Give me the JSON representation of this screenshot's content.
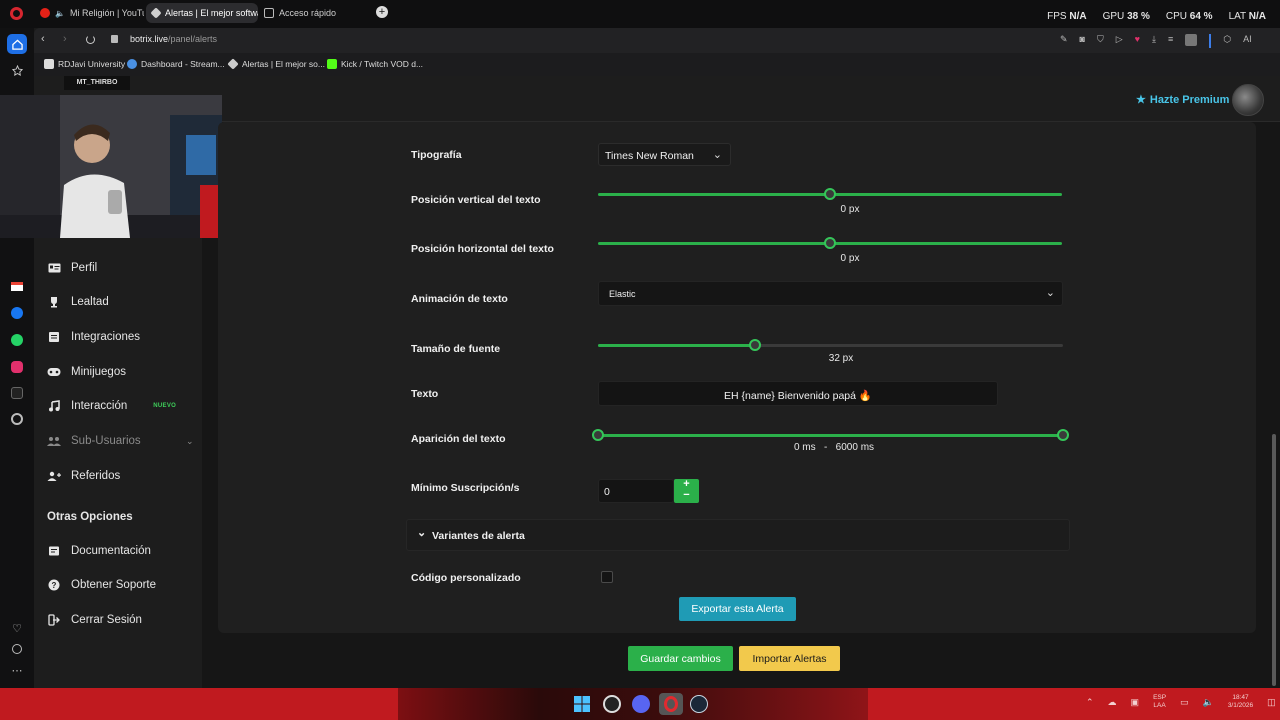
{
  "browser": {
    "tabs": [
      {
        "label": "Mi Religión | YouTube",
        "active": false
      },
      {
        "label": "Alertas | El mejor software",
        "active": true
      },
      {
        "label": "Acceso rápido",
        "active": false
      }
    ],
    "url_host": "botrix.live",
    "url_path": "/panel/alerts",
    "bookmarks": [
      "RDJavi University",
      "Dashboard - Stream...",
      "Alertas | El mejor so...",
      "Kick / Twitch VOD d..."
    ],
    "hud": {
      "fps_label": "FPS",
      "fps_value": "N/A",
      "gpu_label": "GPU",
      "gpu_value": "38 %",
      "cpu_label": "CPU",
      "cpu_value": "64 %",
      "lat_label": "LAT",
      "lat_value": "N/A"
    },
    "ai_label": "AI"
  },
  "stream_overlay": {
    "streamer_tag": "MT_THIRBO"
  },
  "header": {
    "premium_label": "Hazte Premium"
  },
  "sidebar": {
    "items": [
      {
        "label": "Perfil",
        "icon": "id-card-icon"
      },
      {
        "label": "Lealtad",
        "icon": "trophy-icon"
      },
      {
        "label": "Integraciones",
        "icon": "plug-icon"
      },
      {
        "label": "Minijuegos",
        "icon": "gamepad-icon"
      },
      {
        "label": "Interacción",
        "icon": "music-icon",
        "badge": "NUEVO"
      },
      {
        "label": "Sub-Usuarios",
        "icon": "users-icon",
        "muted": true
      },
      {
        "label": "Referidos",
        "icon": "user-plus-icon"
      }
    ],
    "section_title": "Otras Opciones",
    "other_items": [
      {
        "label": "Documentación",
        "icon": "book-icon"
      },
      {
        "label": "Obtener Soporte",
        "icon": "question-icon"
      },
      {
        "label": "Cerrar Sesión",
        "icon": "logout-icon"
      }
    ]
  },
  "form": {
    "font_family": {
      "label": "Tipografía",
      "value": "Times New Roman"
    },
    "vertical_position": {
      "label": "Posición vertical del texto",
      "value": "0",
      "unit": "px",
      "fraction": 0.5
    },
    "horizontal_position": {
      "label": "Posición horizontal del texto",
      "value": "0",
      "unit": "px",
      "fraction": 0.5
    },
    "text_animation": {
      "label": "Animación de texto",
      "value": "Elastic"
    },
    "font_size": {
      "label": "Tamaño de fuente",
      "value": "32",
      "unit": "px",
      "fraction": 0.337
    },
    "text": {
      "label": "Texto",
      "value": "EH {name} Bienvenido papá 🔥"
    },
    "text_appearance": {
      "label": "Aparición del texto",
      "start": "0",
      "end": "6000",
      "unit": "ms",
      "separator": "-"
    },
    "min_subs": {
      "label": "Mínimo Suscripción/s",
      "value": "0"
    },
    "alert_variants": {
      "label": "Variantes de alerta"
    },
    "custom_code": {
      "label": "Código personalizado",
      "checked": false
    }
  },
  "buttons": {
    "export": "Exportar esta Alerta",
    "save": "Guardar cambios",
    "import": "Importar Alertas"
  },
  "colors": {
    "accent_green": "#2bb04a",
    "export_blue": "#1f9bb5",
    "import_yellow": "#f2c94c",
    "premium_cyan": "#49c5e8"
  },
  "taskbar": {
    "lang": "ESP",
    "region": "LAA",
    "time": "18:47",
    "date": "3/1/2026"
  }
}
